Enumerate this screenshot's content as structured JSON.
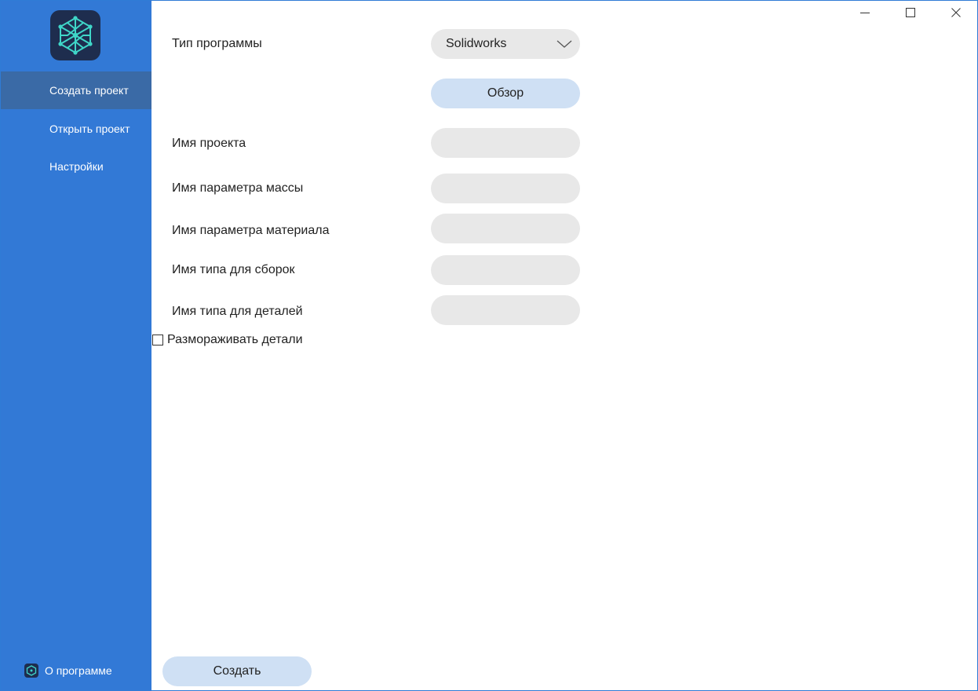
{
  "sidebar": {
    "logo_icon": "hex-network-icon",
    "items": [
      {
        "label": "Создать проект",
        "active": true
      },
      {
        "label": "Открыть проект",
        "active": false
      },
      {
        "label": "Настройки",
        "active": false
      }
    ],
    "about_label": "О программе",
    "about_icon": "app-logo-icon"
  },
  "window_controls": {
    "minimize_icon": "minimize-icon",
    "maximize_icon": "maximize-icon",
    "close_icon": "close-icon"
  },
  "form": {
    "program_type_label": "Тип программы",
    "program_type_value": "Solidworks",
    "browse_label": "Обзор",
    "project_name_label": "Имя проекта",
    "project_name_value": "",
    "mass_param_label": "Имя параметра массы",
    "mass_param_value": "",
    "material_param_label": "Имя параметра материала",
    "material_param_value": "",
    "assembly_type_label": "Имя типа для сборок",
    "assembly_type_value": "",
    "part_type_label": "Имя типа для деталей",
    "part_type_value": "",
    "unfreeze_label": "Размораживать детали",
    "unfreeze_checked": false,
    "create_label": "Создать"
  },
  "colors": {
    "sidebar": "#3279d6",
    "sidebar_active": "#3a6aa6",
    "logo_bg": "#1e2d4e",
    "logo_accent": "#3fd6c8",
    "input_bg": "#e8e8e8",
    "button_bg": "#cfe0f4"
  }
}
